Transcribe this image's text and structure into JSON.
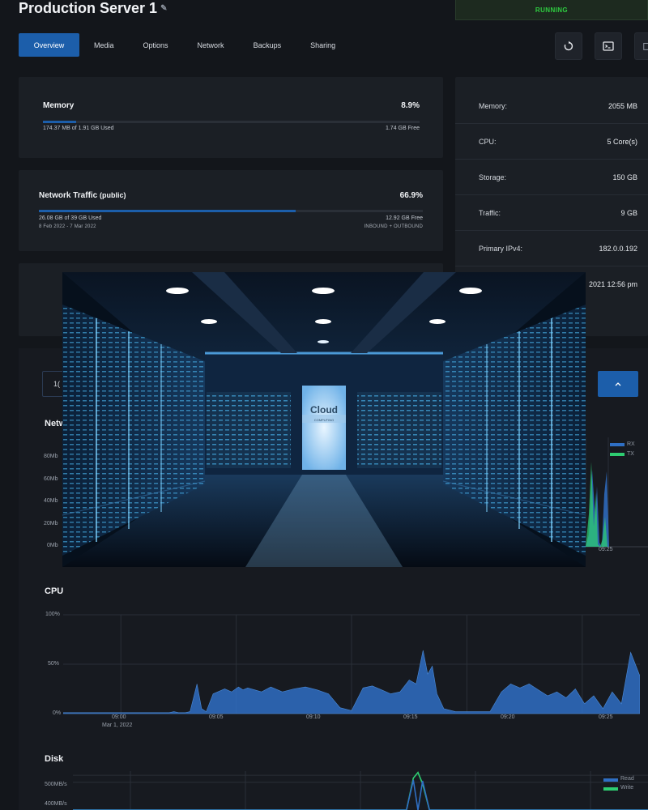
{
  "server": {
    "name": "Production Server 1",
    "status": "RUNNING"
  },
  "tabs": [
    "Overview",
    "Media",
    "Options",
    "Network",
    "Backups",
    "Sharing"
  ],
  "toolbar": {
    "restart_icon": "restart-icon",
    "console_icon": "console-icon",
    "more_icon": "partial-icon"
  },
  "memory": {
    "label": "Memory",
    "percent": "8.9%",
    "fill": 0.089,
    "used": "174.37 MB of 1.91 GB Used",
    "free": "1.74 GB Free"
  },
  "traffic": {
    "label": "Network Traffic",
    "label_suffix": "(public)",
    "percent": "66.9%",
    "fill": 0.669,
    "used": "26.08 GB of 39 GB Used",
    "free": "12.92 GB Free",
    "period": "8 Feb 2022 - 7 Mar 2022",
    "direction": "INBOUND + OUTBOUND"
  },
  "specs": [
    {
      "key": "Memory:",
      "value": "2055 MB"
    },
    {
      "key": "CPU:",
      "value": "5 Core(s)"
    },
    {
      "key": "Storage:",
      "value": "150 GB"
    },
    {
      "key": "Traffic:",
      "value": "9 GB"
    },
    {
      "key": "Primary IPv4:",
      "value": "182.0.0.192"
    },
    {
      "key": "",
      "value": "2021 12:56 pm"
    }
  ],
  "controls": {
    "left_partial": "1(",
    "collapse_icon": "chevron-up-icon"
  },
  "network_chart": {
    "title_partial": "Netw",
    "y_ticks": [
      "80Mb",
      "60Mb",
      "40Mb",
      "20Mb",
      "0Mb"
    ],
    "legend": [
      {
        "name": "RX",
        "color": "#2f6fc4"
      },
      {
        "name": "TX",
        "color": "#2ecc71"
      }
    ],
    "visible_x_tick": "09:25"
  },
  "photo": {
    "sign_text": "Cloud",
    "sign_sub": "COMPUTING"
  },
  "chart_data": [
    {
      "type": "area",
      "title": "CPU",
      "y_ticks": [
        "100%",
        "50%",
        "0%"
      ],
      "x_ticks": [
        "09:00",
        "09:05",
        "09:10",
        "09:15",
        "09:20",
        "09:25"
      ],
      "x_sublabel": "Mar 1, 2022",
      "ylim": [
        0,
        100
      ],
      "x": [
        0,
        1,
        2,
        3,
        4,
        4.6,
        4.8,
        5.0,
        5.3,
        5.5,
        5.8,
        6.0,
        6.2,
        6.5,
        7.0,
        7.3,
        7.6,
        7.8,
        8.0,
        8.3,
        8.6,
        9.0,
        9.5,
        10,
        10.5,
        11,
        11.5,
        12,
        12.5,
        13,
        13.4,
        13.8,
        14.2,
        14.6,
        15.0,
        15.3,
        15.6,
        15.8,
        16.0,
        16.2,
        16.5,
        17,
        17.5,
        18,
        18.5,
        19,
        19.4,
        19.8,
        20.2,
        20.6,
        21,
        21.4,
        21.8,
        22.2,
        22.6,
        23,
        23.4,
        23.8,
        24.2,
        24.6,
        25
      ],
      "series": [
        {
          "color": "#2f6fc4",
          "values": [
            1,
            1,
            1,
            1,
            1,
            1,
            2,
            1,
            1,
            2,
            30,
            5,
            2,
            20,
            25,
            22,
            27,
            24,
            26,
            24,
            22,
            27,
            22,
            25,
            27,
            24,
            20,
            6,
            3,
            26,
            28,
            24,
            20,
            22,
            34,
            30,
            64,
            40,
            48,
            20,
            5,
            2,
            2,
            2,
            2,
            22,
            30,
            26,
            30,
            24,
            18,
            22,
            16,
            25,
            10,
            18,
            5,
            22,
            10,
            62,
            38
          ]
        }
      ]
    },
    {
      "type": "line",
      "title": "Disk",
      "y_ticks": [
        "500MB/s",
        "400MB/s"
      ],
      "legend": [
        {
          "name": "Read",
          "color": "#2f6fc4"
        },
        {
          "name": "Write",
          "color": "#2ecc71"
        }
      ],
      "x": [
        0,
        10,
        14.5,
        14.8,
        15.0,
        15.2,
        15.5,
        25
      ],
      "series": [
        {
          "name": "Write",
          "color": "#2ecc71",
          "values": [
            0,
            0,
            0,
            460,
            540,
            380,
            0,
            0
          ]
        },
        {
          "name": "Read",
          "color": "#2f6fc4",
          "values": [
            0,
            0,
            0,
            430,
            0,
            420,
            0,
            0
          ]
        }
      ]
    }
  ]
}
